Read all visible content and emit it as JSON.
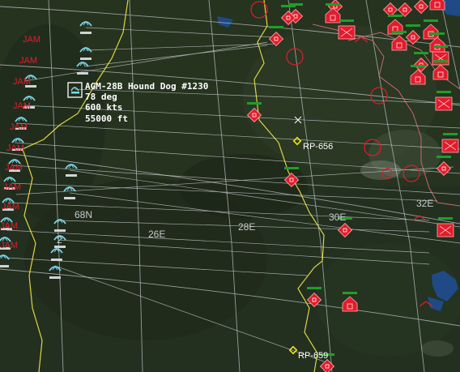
{
  "map": {
    "selected_unit": {
      "name": "AGM-28B Hound Dog #1230",
      "heading": "78 deg",
      "speed": "600 kts",
      "altitude": "55000 ft"
    },
    "jam_label": "JAM",
    "reference_points": [
      {
        "id": "rp1",
        "label": "RP-656"
      },
      {
        "id": "rp2",
        "label": "RP-659"
      }
    ],
    "grid_labels": {
      "lat_68": "68N",
      "lon_26": "26E",
      "lon_28": "28E",
      "lon_30": "30E",
      "lon_32": "32E"
    },
    "colors": {
      "hostile": "#e21c2c",
      "friendly": "#7fd6ea",
      "border": "#e0d640",
      "grid": "#bfc4c6",
      "reference_point": "#f2e21a",
      "unit_status_bar": "#1f9e2a"
    }
  }
}
